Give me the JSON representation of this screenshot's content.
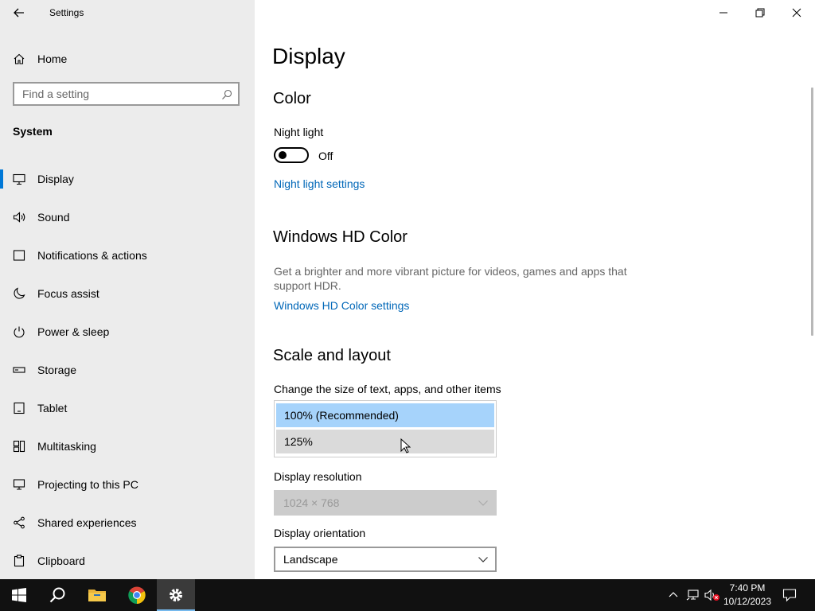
{
  "window": {
    "title": "Settings"
  },
  "sidebar": {
    "home_label": "Home",
    "search_placeholder": "Find a setting",
    "section_title": "System",
    "items": [
      {
        "label": "Display",
        "icon": "monitor-icon",
        "active": true
      },
      {
        "label": "Sound",
        "icon": "speaker-icon"
      },
      {
        "label": "Notifications & actions",
        "icon": "notification-icon"
      },
      {
        "label": "Focus assist",
        "icon": "moon-icon"
      },
      {
        "label": "Power & sleep",
        "icon": "power-icon"
      },
      {
        "label": "Storage",
        "icon": "storage-icon"
      },
      {
        "label": "Tablet",
        "icon": "tablet-icon"
      },
      {
        "label": "Multitasking",
        "icon": "multitasking-icon"
      },
      {
        "label": "Projecting to this PC",
        "icon": "projecting-icon"
      },
      {
        "label": "Shared experiences",
        "icon": "shared-experiences-icon"
      },
      {
        "label": "Clipboard",
        "icon": "clipboard-icon"
      }
    ]
  },
  "main": {
    "page_title": "Display",
    "color": {
      "heading": "Color",
      "night_light_label": "Night light",
      "night_light_state": "Off",
      "night_light_link": "Night light settings"
    },
    "hd_color": {
      "heading": "Windows HD Color",
      "description": "Get a brighter and more vibrant picture for videos, games and apps that support HDR.",
      "link": "Windows HD Color settings"
    },
    "scale_layout": {
      "heading": "Scale and layout",
      "scale_label": "Change the size of text, apps, and other items",
      "scale_options": [
        "100% (Recommended)",
        "125%"
      ],
      "scale_selected": "100% (Recommended)",
      "resolution_label": "Display resolution",
      "resolution_value": "1024 × 768",
      "orientation_label": "Display orientation",
      "orientation_value": "Landscape"
    }
  },
  "taskbar": {
    "time": "7:40 PM",
    "date": "10/12/2023",
    "apps": [
      "start-icon",
      "search-icon",
      "file-explorer-icon",
      "chrome-icon",
      "settings-icon"
    ]
  },
  "colors": {
    "accent": "#0078d7",
    "link": "#0067b8",
    "selected_option": "#a6d3fb",
    "sidebar_bg": "#ececec",
    "taskbar_bg": "#111111"
  }
}
